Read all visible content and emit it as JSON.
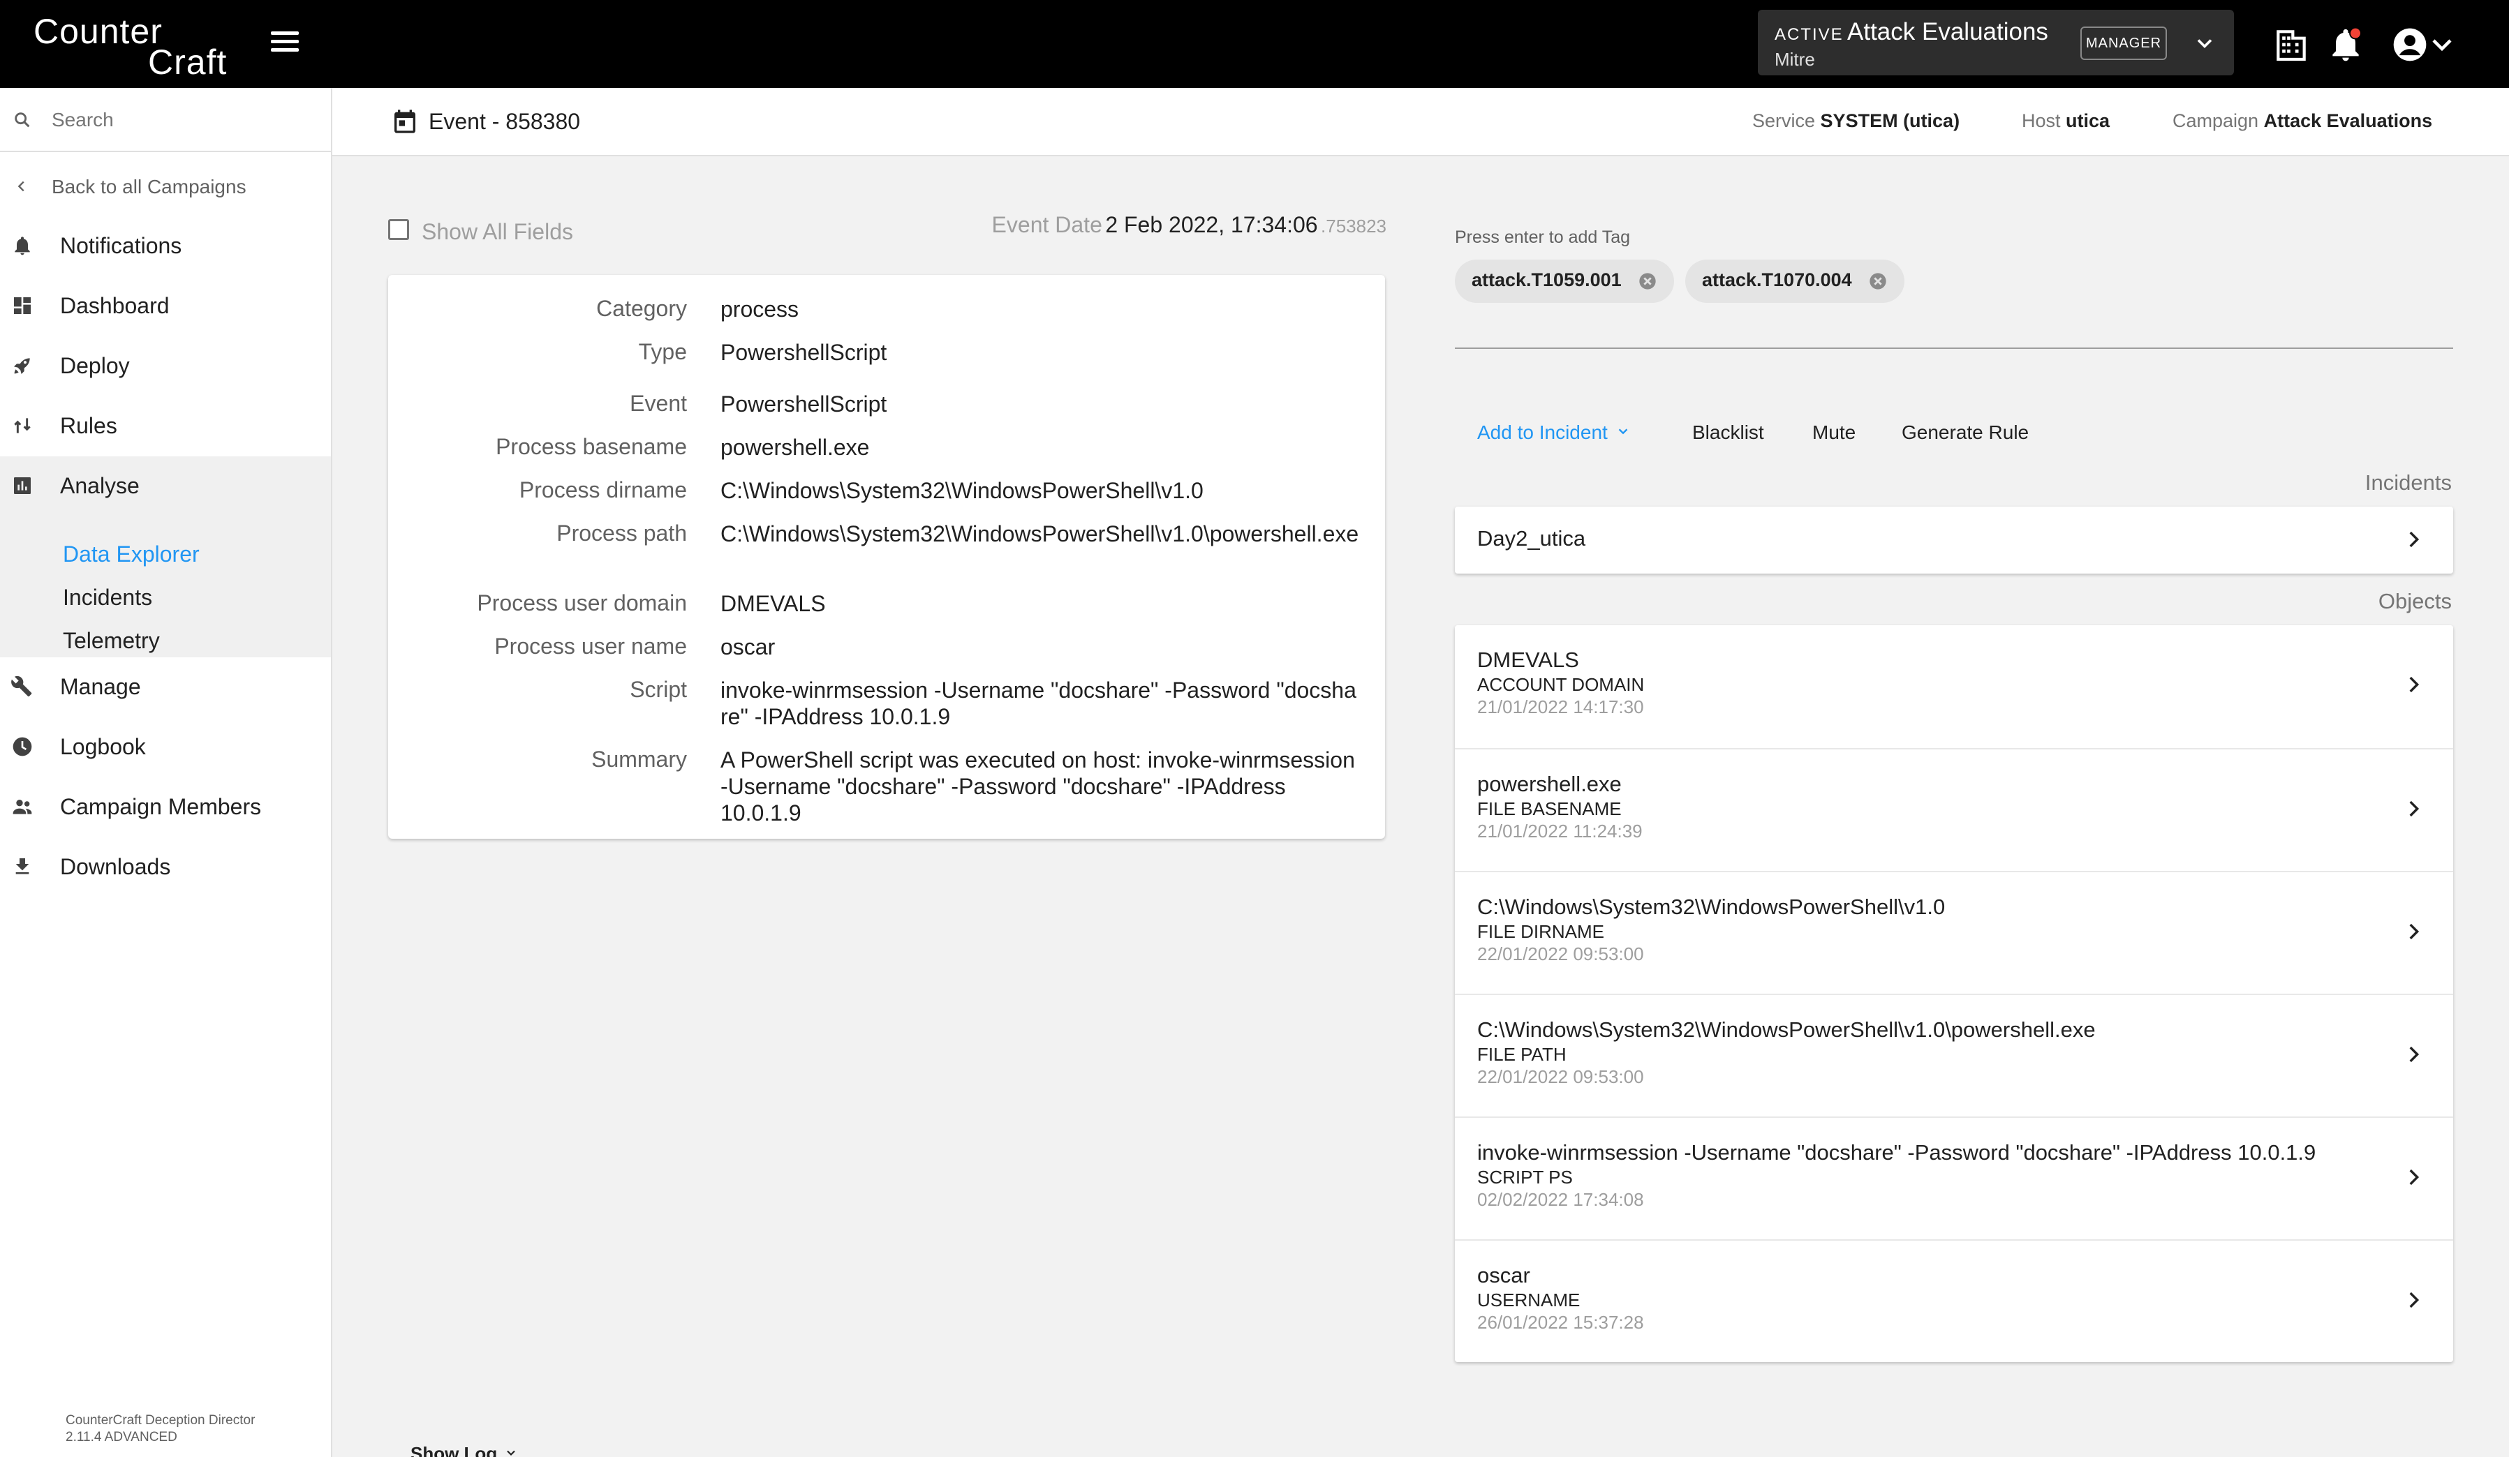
{
  "app": {
    "logo_line1": "Counter",
    "logo_line2": "Craft"
  },
  "campaign_switcher": {
    "status": "ACTIVE",
    "name": "Attack Evaluations",
    "organization": "Mitre",
    "role": "MANAGER"
  },
  "sidebar": {
    "search_placeholder": "Search",
    "back_label": "Back to all Campaigns",
    "items": [
      {
        "label": "Notifications",
        "icon": "bell-icon"
      },
      {
        "label": "Dashboard",
        "icon": "dashboard-icon"
      },
      {
        "label": "Deploy",
        "icon": "rocket-icon"
      },
      {
        "label": "Rules",
        "icon": "rules-icon"
      },
      {
        "label": "Analyse",
        "icon": "chart-icon"
      },
      {
        "label": "Manage",
        "icon": "wrench-icon"
      },
      {
        "label": "Logbook",
        "icon": "clock-icon"
      },
      {
        "label": "Campaign Members",
        "icon": "people-icon"
      },
      {
        "label": "Downloads",
        "icon": "download-icon"
      }
    ],
    "analyse_sub": [
      {
        "label": "Data Explorer",
        "active": true
      },
      {
        "label": "Incidents",
        "active": false
      },
      {
        "label": "Telemetry",
        "active": false
      }
    ],
    "version_line1": "CounterCraft Deception Director",
    "version_line2": "2.11.4 ADVANCED"
  },
  "subheader": {
    "title": "Event - 858380",
    "service_label": "Service",
    "service_value": "SYSTEM (utica)",
    "host_label": "Host",
    "host_value": "utica",
    "campaign_label": "Campaign",
    "campaign_value": "Attack Evaluations"
  },
  "event": {
    "show_all_label": "Show All Fields",
    "date_label": "Event Date",
    "date_value": "2 Feb 2022, 17:34:06",
    "date_ms": ".753823",
    "fields": [
      {
        "key": "Category",
        "value": "process"
      },
      {
        "key": "Type",
        "value": "PowershellScript"
      },
      {
        "key": "Event",
        "value": "PowershellScript"
      },
      {
        "key": "Process basename",
        "value": "powershell.exe"
      },
      {
        "key": "Process dirname",
        "value": "C:\\Windows\\System32\\WindowsPowerShell\\v1.0"
      },
      {
        "key": "Process path",
        "value": "C:\\Windows\\System32\\WindowsPowerShell\\v1.0\\powershell.exe"
      },
      {
        "key": "Process user domain",
        "value": "DMEVALS"
      },
      {
        "key": "Process user name",
        "value": "oscar"
      },
      {
        "key": "Script",
        "value": "invoke-winrmsession -Username \"docshare\" -Password \"docshare\" -IPAddress 10.0.1.9"
      },
      {
        "key": "Summary",
        "value": "A PowerShell script was executed on host: invoke-winrmsession -Username \"docshare\" -Password \"docshare\" -IPAddress 10.0.1.9"
      }
    ]
  },
  "tags": {
    "hint": "Press enter to add Tag",
    "items": [
      "attack.T1059.001",
      "attack.T1070.004"
    ]
  },
  "actions": {
    "add_to_incident": "Add to Incident",
    "blacklist": "Blacklist",
    "mute": "Mute",
    "generate_rule": "Generate Rule"
  },
  "incidents": {
    "label": "Incidents",
    "items": [
      "Day2_utica"
    ]
  },
  "objects": {
    "label": "Objects",
    "items": [
      {
        "title": "DMEVALS",
        "type": "ACCOUNT DOMAIN",
        "date": "21/01/2022 14:17:30"
      },
      {
        "title": "powershell.exe",
        "type": "FILE BASENAME",
        "date": "21/01/2022 11:24:39"
      },
      {
        "title": "C:\\Windows\\System32\\WindowsPowerShell\\v1.0",
        "type": "FILE DIRNAME",
        "date": "22/01/2022 09:53:00"
      },
      {
        "title": "C:\\Windows\\System32\\WindowsPowerShell\\v1.0\\powershell.exe",
        "type": "FILE PATH",
        "date": "22/01/2022 09:53:00"
      },
      {
        "title": "invoke-winrmsession -Username \"docshare\" -Password \"docshare\" -IPAddress 10.0.1.9",
        "type": "SCRIPT PS",
        "date": "02/02/2022 17:34:08"
      },
      {
        "title": "oscar",
        "type": "USERNAME",
        "date": "26/01/2022 15:37:28"
      }
    ]
  },
  "footer": {
    "show_log": "Show Log"
  },
  "colors": {
    "accent": "#2196f3",
    "topbar": "#000000",
    "notification_dot": "#f44336"
  }
}
